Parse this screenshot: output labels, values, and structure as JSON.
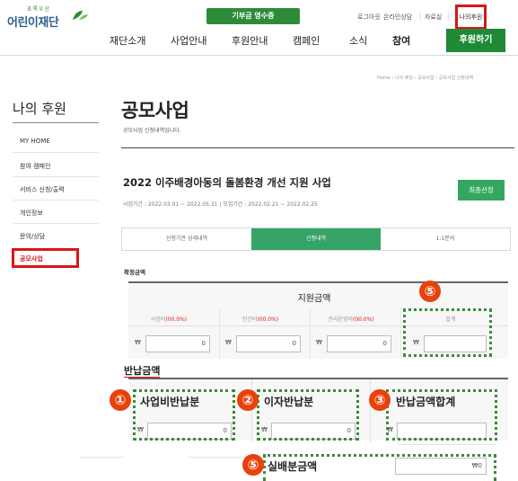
{
  "header": {
    "logo_sub": "초록우산",
    "logo_text": "어린이재단",
    "receipt_button": "기부금 영수증",
    "utility": [
      "로그아웃",
      "온라인상담",
      "자료실",
      "나의후원"
    ],
    "nav": [
      "재단소개",
      "사업안내",
      "후원안내",
      "캠페인",
      "소식",
      "참여"
    ],
    "active_nav": "참여",
    "donate_button": "후원하기",
    "brand_color": "#1f8a35",
    "highlight_color": "#d9161b"
  },
  "breadcrumb": "Home › 나의 후원 › 공모사업 › 공모사업 신청내역",
  "sidebar": {
    "title": "나의 후원",
    "items": [
      "MY HOME",
      "참여 캠페인",
      "서비스 신청/출력",
      "개인정보",
      "문의/상담",
      "공모사업"
    ],
    "active": "공모사업"
  },
  "main": {
    "title": "공모사업",
    "description": "공모사업 신청내역입니다.",
    "project_title": "2022 이주배경아동의 돌봄환경 개선 지원 사업",
    "project_dates": "사업기간 : 2022.03.01 ~ 2022.05.31   |   모집기간 : 2022.02.21 ~ 2022.02.25",
    "status_button": "최종선정",
    "tabs": [
      "신청기관 상세내역",
      "신청내역",
      "1:1문의"
    ],
    "active_tab": "신청내역",
    "confirmed_label": "확정금액",
    "support_header": "지원금액",
    "columns": [
      {
        "name": "사업비",
        "pct": "(00.0%)"
      },
      {
        "name": "인건비",
        "pct": "(00.0%)"
      },
      {
        "name": "관리운영비",
        "pct": "(00.0%)"
      },
      {
        "name": "합계",
        "pct": ""
      }
    ],
    "currency": "₩",
    "values": [
      "0",
      "0",
      "0",
      ""
    ],
    "refund_label": "반납금액",
    "refund_columns": [
      "사업비반납분",
      "이자반납분",
      "반납금액합계"
    ],
    "refund_values": [
      "0",
      "0",
      ""
    ],
    "actual_label": "실배분금액",
    "actual_value": "₩0"
  },
  "annotations": {
    "badges": [
      "①",
      "②",
      "③",
      "⑤",
      "⑤"
    ],
    "badge_color": "#e8410a",
    "dotted_color": "#3f8a3a"
  }
}
